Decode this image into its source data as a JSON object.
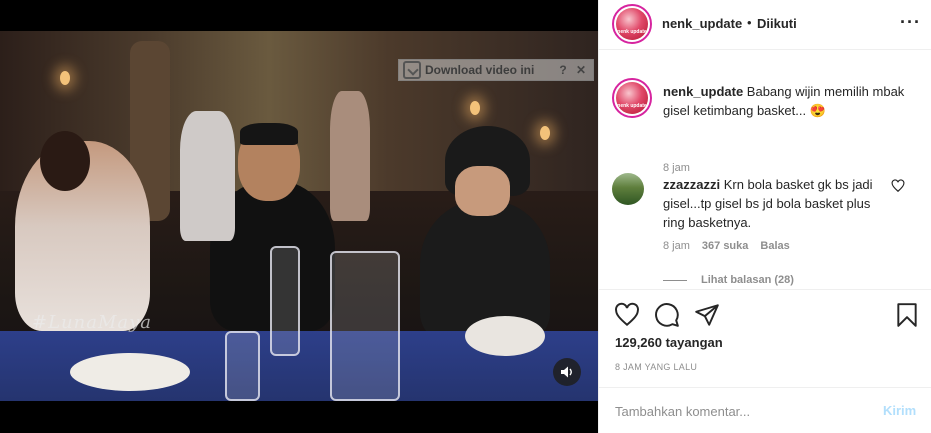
{
  "video": {
    "download_badge": {
      "label": "Download video ini",
      "help": "?",
      "close": "✕"
    },
    "watermark": "#LunaMaya",
    "mute_icon": "speaker-icon"
  },
  "header": {
    "username": "nenk_update",
    "separator": "•",
    "follow_status": "Diikuti",
    "avatar_text": "nenk update",
    "more_icon": "more-options-icon",
    "more_label": "···"
  },
  "caption": {
    "username": "nenk_update",
    "text": " Babang wijin memilih mbak gisel ketimbang basket... 😍",
    "time": "8 jam"
  },
  "comment": {
    "username": "zzazzazzi",
    "text": " Krn bola basket gk bs jadi gisel...tp gisel bs jd bola basket plus ring basketnya.",
    "time": "8 jam",
    "likes": "367 suka",
    "reply_label": "Balas",
    "view_replies": "Lihat balasan (28)"
  },
  "actions": {
    "icons": [
      "heart-icon",
      "comment-icon",
      "share-icon",
      "bookmark-icon"
    ],
    "views": "129,260 tayangan",
    "time_ago": "8 JAM YANG LALU"
  },
  "add_comment": {
    "placeholder": "Tambahkan komentar...",
    "send_label": "Kirim"
  },
  "colors": {
    "link_disabled": "#b2dffc",
    "muted": "#8e8e8e",
    "text": "#262626",
    "border": "#efefef"
  }
}
